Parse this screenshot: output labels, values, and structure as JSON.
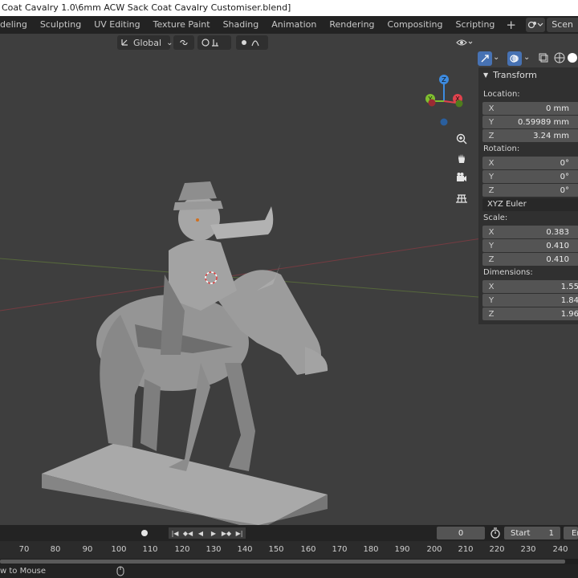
{
  "window": {
    "title": "Coat Cavalry 1.0\\6mm ACW Sack Coat Cavalry Customiser.blend]"
  },
  "workspaces": [
    "deling",
    "Sculpting",
    "UV Editing",
    "Texture Paint",
    "Shading",
    "Animation",
    "Rendering",
    "Compositing",
    "Scripting"
  ],
  "workspace_add": "+",
  "scene": {
    "label": "Scen",
    "icon": "scene-icon"
  },
  "viewport_header": {
    "orientation": "Global"
  },
  "gizmo": {
    "z": "Z",
    "y": "Y",
    "x": "X"
  },
  "nav_icons": [
    "zoom-icon",
    "hand-icon",
    "camera-icon",
    "grid-icon"
  ],
  "npanel": {
    "title": "Transform",
    "location_label": "Location:",
    "location": [
      {
        "axis": "X",
        "value": "0 mm"
      },
      {
        "axis": "Y",
        "value": "0.59989 mm"
      },
      {
        "axis": "Z",
        "value": "3.24 mm"
      }
    ],
    "rotation_label": "Rotation:",
    "rotation": [
      {
        "axis": "X",
        "value": "0°"
      },
      {
        "axis": "Y",
        "value": "0°"
      },
      {
        "axis": "Z",
        "value": "0°"
      }
    ],
    "rotation_mode": "XYZ Euler",
    "scale_label": "Scale:",
    "scale": [
      {
        "axis": "X",
        "value": "0.383"
      },
      {
        "axis": "Y",
        "value": "0.410"
      },
      {
        "axis": "Z",
        "value": "0.410"
      }
    ],
    "dimensions_label": "Dimensions:",
    "dimensions": [
      {
        "axis": "X",
        "value": "1.55"
      },
      {
        "axis": "Y",
        "value": "1.84"
      },
      {
        "axis": "Z",
        "value": "1.96"
      }
    ]
  },
  "timeline": {
    "current_frame": "0",
    "start_label": "Start",
    "start_value": "1",
    "end_label": "En",
    "ticks": [
      "70",
      "80",
      "90",
      "100",
      "110",
      "120",
      "130",
      "140",
      "150",
      "160",
      "170",
      "180",
      "190",
      "200",
      "210",
      "220",
      "230",
      "240"
    ]
  },
  "status": {
    "text": "w to Mouse"
  },
  "colors": {
    "accent": "#4772b3",
    "axis_x": "#e0424d",
    "axis_y": "#7fbf2f",
    "axis_z": "#3d8be0"
  }
}
